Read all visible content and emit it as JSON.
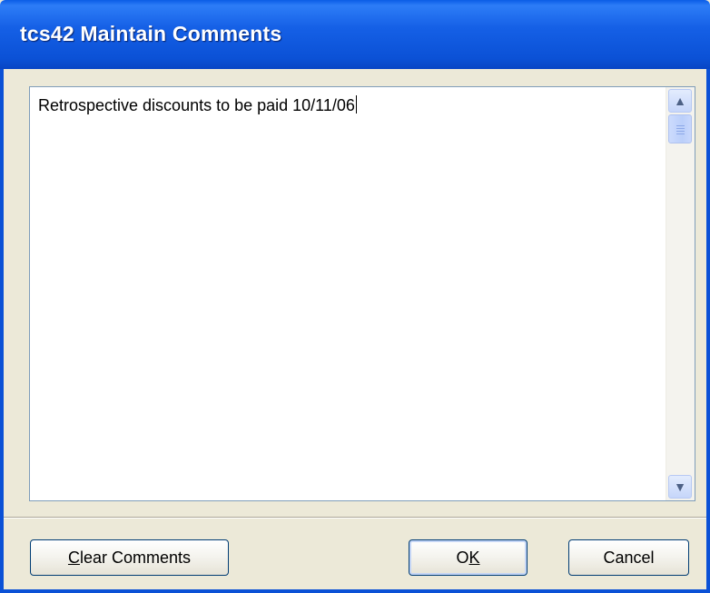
{
  "window": {
    "title": "tcs42 Maintain Comments"
  },
  "comments": {
    "text": "Retrospective discounts to be paid 10/11/06"
  },
  "scrollbar": {
    "up_glyph": "▲",
    "down_glyph": "▼"
  },
  "buttons": {
    "clear_mnemonic": "C",
    "clear_rest": "lear Comments",
    "ok_pre": "O",
    "ok_mnemonic": "K",
    "cancel_label": "Cancel"
  },
  "colors": {
    "titlebar": "#0B51D6",
    "dialog_bg": "#ECE9D8",
    "button_border": "#003C74"
  }
}
